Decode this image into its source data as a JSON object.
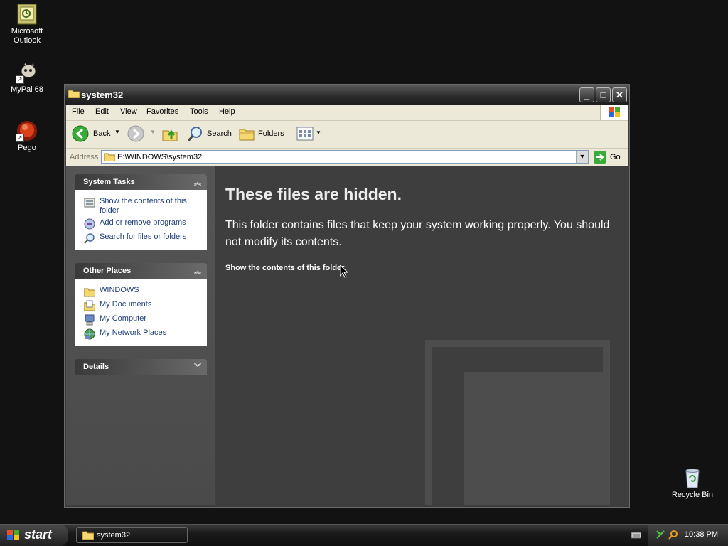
{
  "desktop": {
    "icons": [
      {
        "label": "Microsoft Outlook"
      },
      {
        "label": "MyPal 68"
      },
      {
        "label": "Pego"
      },
      {
        "label": "Recycle Bin"
      }
    ]
  },
  "window": {
    "title": "system32",
    "menu": [
      "File",
      "Edit",
      "View",
      "Favorites",
      "Tools",
      "Help"
    ],
    "toolbar": {
      "back_label": "Back",
      "search_label": "Search",
      "folders_label": "Folders"
    },
    "address": {
      "label": "Address",
      "value": "E:\\WINDOWS\\system32",
      "go_label": "Go"
    },
    "taskpane": {
      "system_tasks": {
        "title": "System Tasks",
        "items": [
          "Show the contents of this folder",
          "Add or remove programs",
          "Search for files or folders"
        ]
      },
      "other_places": {
        "title": "Other Places",
        "items": [
          "WINDOWS",
          "My Documents",
          "My Computer",
          "My Network Places"
        ]
      },
      "details": {
        "title": "Details"
      }
    },
    "content": {
      "heading": "These files are hidden.",
      "body": "This folder contains files that keep your system working properly. You should not modify its contents.",
      "link": "Show the contents of this folder"
    }
  },
  "taskbar": {
    "start_label": "start",
    "task_label": "system32",
    "clock": "10:38 PM"
  },
  "colors": {
    "desktop": "#121212",
    "window_frame": "#3c3c3c",
    "menubar": "#ece9d8",
    "link": "#1f3f7a"
  }
}
